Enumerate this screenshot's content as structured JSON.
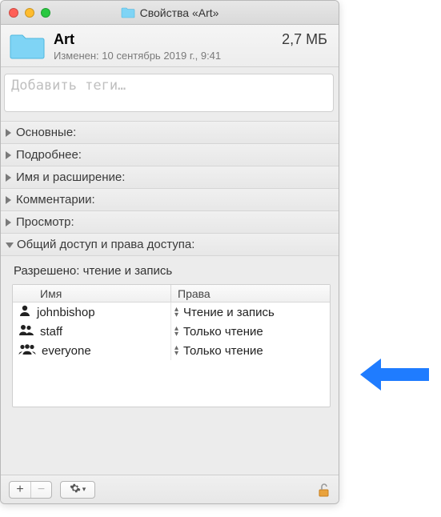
{
  "window_title": "Свойства «Art»",
  "header": {
    "name": "Art",
    "size": "2,7 МБ",
    "modified": "Изменен: 10 сентябрь 2019 г., 9:41"
  },
  "tags": {
    "placeholder": "Добавить теги…",
    "value": ""
  },
  "sections": {
    "general": "Основные:",
    "more": "Подробнее:",
    "nameext": "Имя и расширение:",
    "comments": "Комментарии:",
    "preview": "Просмотр:",
    "sharing": "Общий доступ и права доступа:"
  },
  "sharing": {
    "perm_line": "Разрешено: чтение и запись",
    "col_name": "Имя",
    "col_priv": "Права",
    "rows": [
      {
        "icon": "single",
        "name": "johnbishop",
        "priv": "Чтение и запись"
      },
      {
        "icon": "double",
        "name": "staff",
        "priv": "Только чтение"
      },
      {
        "icon": "group",
        "name": "everyone",
        "priv": "Только чтение"
      }
    ]
  },
  "footer": {
    "add": "+",
    "remove": "−"
  }
}
